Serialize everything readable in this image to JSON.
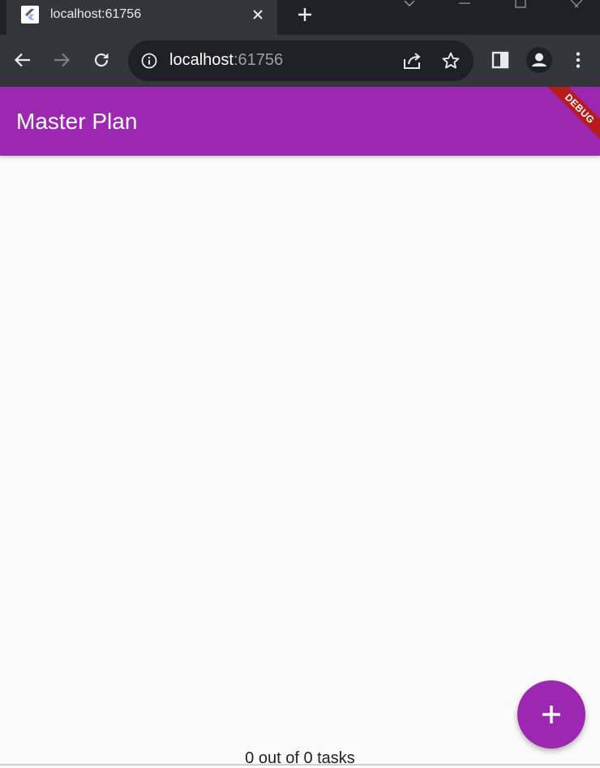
{
  "browser": {
    "tab": {
      "title": "localhost:61756",
      "favicon": "flutter-icon"
    },
    "address": {
      "host": "localhost",
      "port": ":61756"
    },
    "icons": {
      "back": "arrow-left-icon",
      "forward": "arrow-right-icon",
      "reload": "reload-icon",
      "info": "info-icon",
      "share": "share-icon",
      "bookmark": "star-icon",
      "side_panel": "side-panel-icon",
      "profile": "profile-icon",
      "menu": "more-vert-icon"
    },
    "colors": {
      "tabstrip": "#202124",
      "toolbar": "#35363a",
      "omnibox": "#202124"
    }
  },
  "app": {
    "title": "Master Plan",
    "debug_banner": "DEBUG",
    "fab_icon": "add-icon",
    "footer": "0 out of 0 tasks",
    "colors": {
      "primary": "#9c27b0",
      "background": "#fafafa",
      "debug": "#b71c1c"
    }
  }
}
